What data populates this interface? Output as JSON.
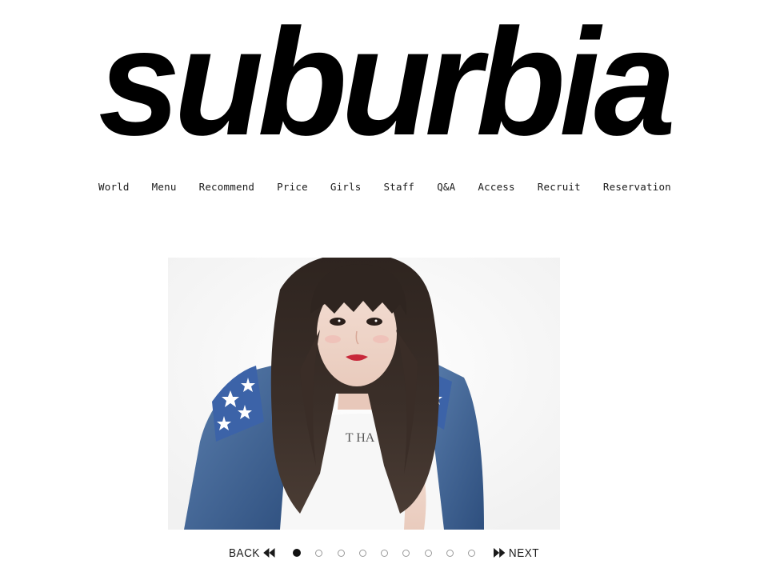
{
  "brand": {
    "logo_text": "suburbia"
  },
  "nav": {
    "items": [
      {
        "label": "World"
      },
      {
        "label": "Menu"
      },
      {
        "label": "Recommend"
      },
      {
        "label": "Price"
      },
      {
        "label": "Girls"
      },
      {
        "label": "Staff"
      },
      {
        "label": "Q&A"
      },
      {
        "label": "Access"
      },
      {
        "label": "Recruit"
      },
      {
        "label": "Reservation"
      }
    ]
  },
  "slider": {
    "back_label": "BACK",
    "next_label": "NEXT",
    "shirt_text": "T HA",
    "dots_total": 9,
    "active_index": 0
  },
  "colors": {
    "text": "#1a1a1a",
    "logo": "#000000",
    "dot_inactive_border": "#9a9a9a",
    "dot_active": "#111111"
  },
  "icons": {
    "back": "double-chevron-left-icon",
    "next": "double-chevron-right-icon"
  }
}
